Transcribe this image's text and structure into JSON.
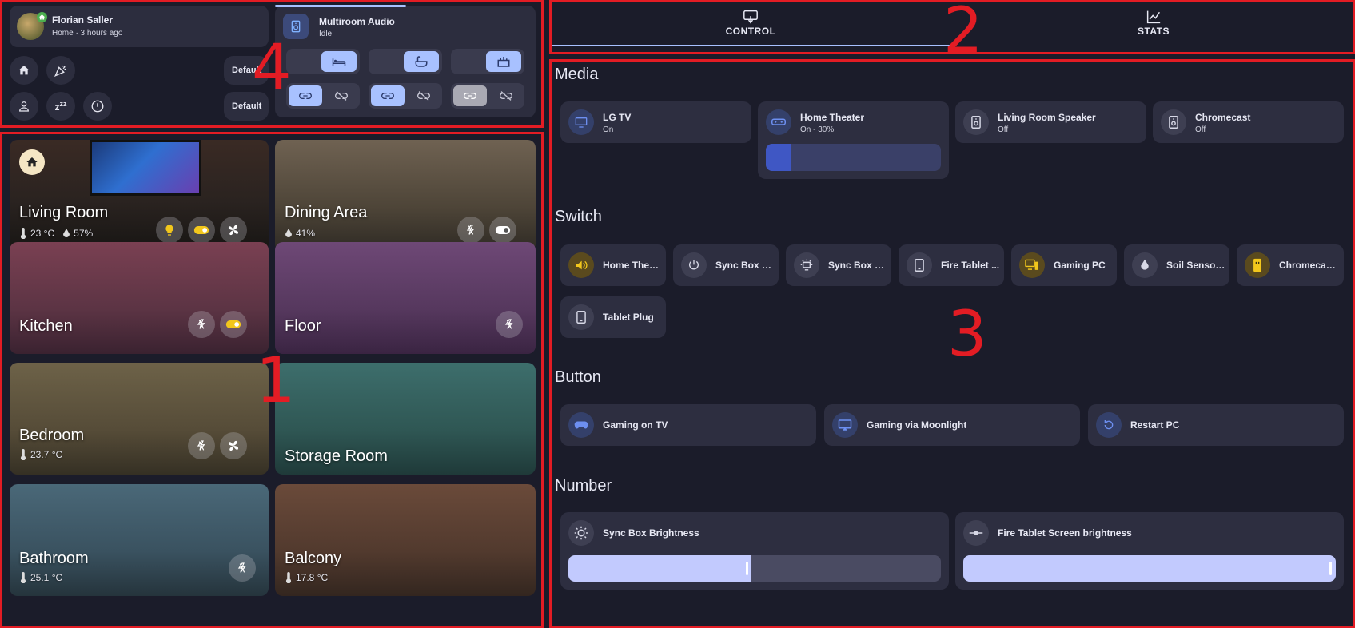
{
  "callouts": [
    "1",
    "2",
    "3",
    "4"
  ],
  "user": {
    "name": "Florian Saller",
    "status": "Home · 3 hours ago"
  },
  "quick_buttons": {
    "default_1": "Default",
    "default_2": "Default"
  },
  "multiroom": {
    "title": "Multiroom Audio",
    "state": "Idle"
  },
  "tabs": [
    {
      "label": "CONTROL",
      "active": true
    },
    {
      "label": "STATS",
      "active": false
    }
  ],
  "rooms": [
    {
      "name": "Living Room",
      "temp": "23 °C",
      "humidity": "57%"
    },
    {
      "name": "Dining Area",
      "humidity": "41%"
    },
    {
      "name": "Kitchen"
    },
    {
      "name": "Floor"
    },
    {
      "name": "Bedroom",
      "temp": "23.7 °C"
    },
    {
      "name": "Storage Room"
    },
    {
      "name": "Bathroom",
      "temp": "25.1 °C"
    },
    {
      "name": "Balcony",
      "temp": "17.8 °C"
    }
  ],
  "sections": {
    "media": "Media",
    "switch": "Switch",
    "button": "Button",
    "number": "Number"
  },
  "media": [
    {
      "name": "LG TV",
      "state": "On",
      "icon": "tv-icon"
    },
    {
      "name": "Home Theater",
      "state": "On - 30%",
      "icon": "soundbar-icon",
      "volume": 0.14
    },
    {
      "name": "Living Room Speaker",
      "state": "Off",
      "icon": "speaker-icon"
    },
    {
      "name": "Chromecast",
      "state": "Off",
      "icon": "speaker-icon"
    }
  ],
  "switches": [
    {
      "name": "Home Thea...",
      "icon": "volume-icon",
      "on": true
    },
    {
      "name": "Sync Box P...",
      "icon": "power-icon",
      "on": false
    },
    {
      "name": "Sync Box Li...",
      "icon": "ambilight-icon",
      "on": false
    },
    {
      "name": "Fire Tablet ...",
      "icon": "tablet-icon",
      "on": false
    },
    {
      "name": "Gaming PC",
      "icon": "desktop-icon",
      "on": true
    },
    {
      "name": "Soil Sensor...",
      "icon": "water-drop-icon",
      "on": false
    },
    {
      "name": "Chromecas...",
      "icon": "plug-icon",
      "on": true
    },
    {
      "name": "Tablet Plug",
      "icon": "tablet-icon",
      "on": false
    }
  ],
  "buttons": [
    {
      "name": "Gaming on TV",
      "icon": "gamepad-icon"
    },
    {
      "name": "Gaming via Moonlight",
      "icon": "cast-icon"
    },
    {
      "name": "Restart PC",
      "icon": "restart-icon"
    }
  ],
  "numbers": [
    {
      "name": "Sync Box Brightness",
      "icon": "brightness-icon",
      "level": 0.49
    },
    {
      "name": "Fire Tablet Screen brightness",
      "icon": "slider-icon",
      "level": 1.0
    }
  ],
  "colors": {
    "accent": "#a8c1ff",
    "active_yellow": "#f2c71c",
    "background": "#1b1c2a",
    "card": "#2c2d3e",
    "annotation": "#e31c24"
  }
}
